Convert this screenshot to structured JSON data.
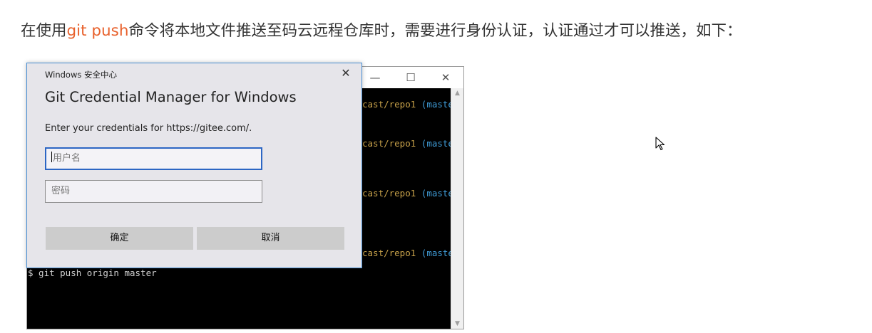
{
  "intro": {
    "before": "在使用",
    "code": "git push",
    "after": "命令将本地文件推送至码云远程仓库时，需要进行身份认证，认证通过才可以推送，如下："
  },
  "terminal": {
    "controls": {
      "minimize": "—",
      "maximize": "☐",
      "close": "✕"
    },
    "prompt_lines": [
      {
        "path": "cast/repo1",
        "branch": "(maste"
      },
      {
        "path": "cast/repo1",
        "branch": "(maste"
      },
      {
        "path": "cast/repo1",
        "branch": "(maste"
      },
      {
        "path": "cast/repo1",
        "branch": "(maste"
      }
    ],
    "command": "$ git push origin master"
  },
  "dialog": {
    "caption": "Windows 安全中心",
    "close": "✕",
    "title": "Git Credential Manager for Windows",
    "prompt": "Enter your credentials for https://gitee.com/.",
    "username_placeholder": "用户名",
    "password_placeholder": "密码",
    "ok_label": "确定",
    "cancel_label": "取消"
  },
  "colors": {
    "accent": "#e8612c",
    "focus_border": "#2c66c4",
    "terminal_path": "#c8a24a",
    "terminal_branch": "#3f9bd6"
  }
}
